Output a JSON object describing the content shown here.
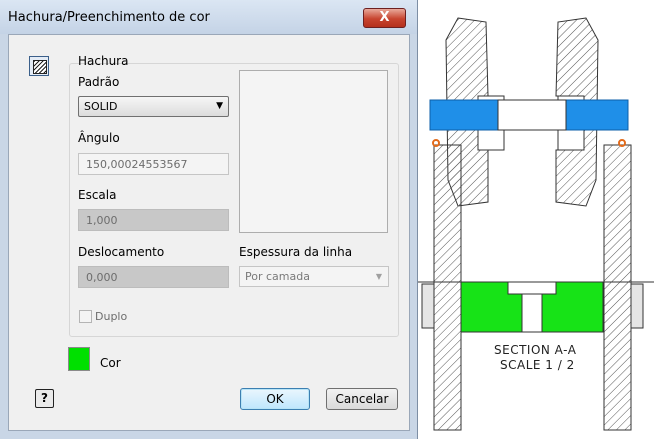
{
  "dialog": {
    "title": "Hachura/Preenchimento de cor",
    "close_glyph": "X",
    "group_title": "Hachura",
    "pattern": {
      "label": "Padrão",
      "value": "SOLID"
    },
    "angle": {
      "label": "Ângulo",
      "value": "150,00024553567"
    },
    "scale": {
      "label": "Escala",
      "value": "1,000"
    },
    "offset": {
      "label": "Deslocamento",
      "value": "0,000"
    },
    "line_weight": {
      "label": "Espessura da linha",
      "value": "Por camada"
    },
    "double": {
      "label": "Duplo",
      "checked": false
    },
    "color": {
      "label": "Cor",
      "swatch": "#00e000"
    },
    "help_glyph": "?",
    "ok_label": "OK",
    "cancel_label": "Cancelar"
  },
  "drawing": {
    "section_label": "SECTION A-A",
    "scale_label": "SCALE 1 / 2",
    "colors": {
      "shaft": "#1f8fe8",
      "fill": "#17e317",
      "hatch": "#555555"
    }
  }
}
